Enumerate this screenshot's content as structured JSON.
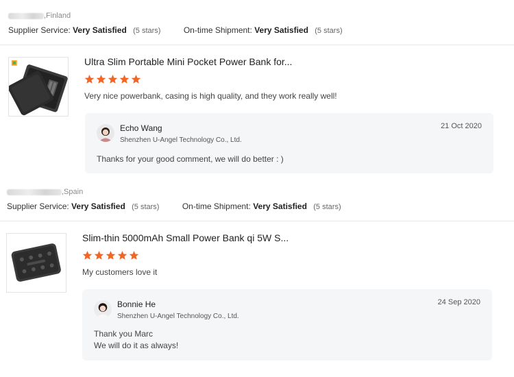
{
  "reviews": [
    {
      "buyer_country": ",Finland",
      "supplier_service_label": "Supplier Service:",
      "supplier_service_value": "Very Satisfied",
      "supplier_service_stars": "(5 stars)",
      "shipment_label": "On-time Shipment:",
      "shipment_value": "Very Satisfied",
      "shipment_stars": "(5 stars)",
      "product_title": "Ultra Slim Portable Mini Pocket Power Bank for...",
      "rating": 5,
      "comment": "Very nice powerbank, casing is high quality, and they work really well!",
      "reply": {
        "name": "Echo Wang",
        "company": "Shenzhen U-Angel Technology Co., Ltd.",
        "date": "21 Oct 2020",
        "text": "Thanks for your good comment, we will do better : )"
      }
    },
    {
      "buyer_country": ",Spain",
      "supplier_service_label": "Supplier Service:",
      "supplier_service_value": "Very Satisfied",
      "supplier_service_stars": "(5 stars)",
      "shipment_label": "On-time Shipment:",
      "shipment_value": "Very Satisfied",
      "shipment_stars": "(5 stars)",
      "product_title": "Slim-thin 5000mAh Small Power Bank qi 5W S...",
      "rating": 5,
      "comment": "My customers love it",
      "reply": {
        "name": "Bonnie He",
        "company": "Shenzhen U-Angel Technology Co., Ltd.",
        "date": "24 Sep 2020",
        "text_line1": "Thank you Marc",
        "text_line2": "We will do it as always!"
      }
    }
  ],
  "colors": {
    "star": "#f26522",
    "reply_bg": "#f5f6f8",
    "divider": "#e8e8e8"
  },
  "icons": {
    "star": "star-icon",
    "product1": "power-bank-product-image",
    "product2": "wireless-power-bank-product-image",
    "avatar": "seller-avatar"
  }
}
